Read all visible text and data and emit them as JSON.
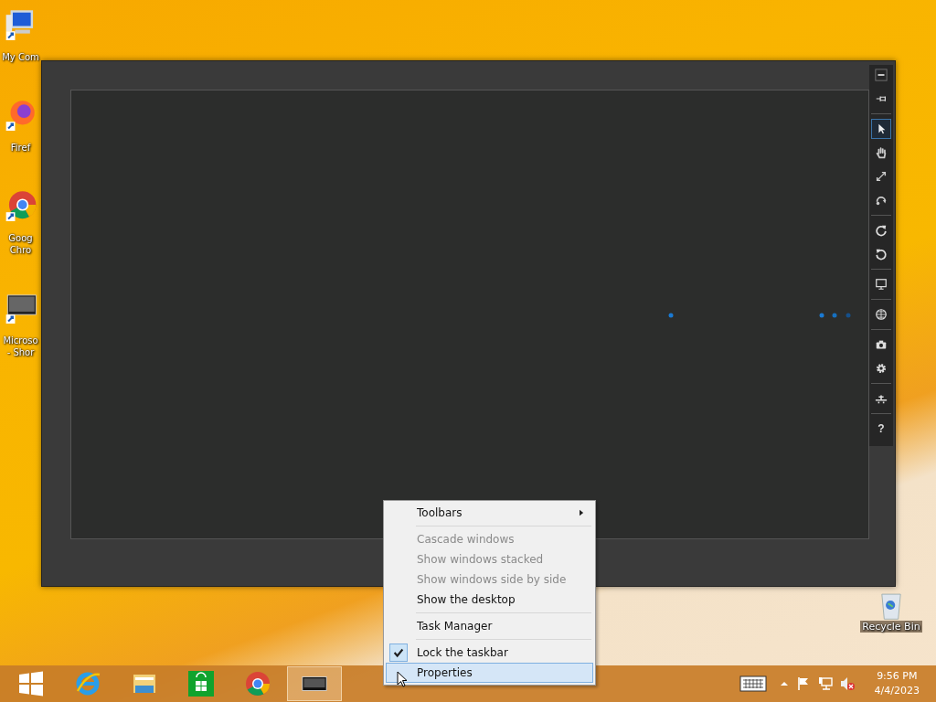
{
  "desktop_icons": [
    {
      "lines": [
        "My Com"
      ]
    },
    {
      "lines": [
        "Firef"
      ]
    },
    {
      "lines": [
        "Goog",
        "Chro"
      ]
    },
    {
      "lines": [
        "Microso",
        "- Shor"
      ]
    }
  ],
  "recycle_bin": {
    "label": "Recycle Bin"
  },
  "app_window": {
    "toolbar_groups": [
      [
        {
          "selected": false
        },
        {
          "selected": false
        }
      ],
      [
        {
          "selected": true
        },
        {
          "selected": false
        },
        {
          "selected": false
        },
        {
          "selected": false
        }
      ],
      [
        {
          "selected": false
        },
        {
          "selected": false
        }
      ],
      [
        {
          "selected": false
        }
      ],
      [
        {
          "selected": false
        }
      ],
      [
        {
          "selected": false
        },
        {
          "selected": false
        }
      ],
      [
        {
          "selected": false
        }
      ],
      [
        {
          "selected": false,
          "text": "?"
        }
      ]
    ]
  },
  "context_menu": [
    {
      "kind": "item",
      "label": "Toolbars",
      "disabled": false,
      "checked": false,
      "selected": false,
      "submenu": true
    },
    {
      "kind": "separator"
    },
    {
      "kind": "item",
      "label": "Cascade windows",
      "disabled": true,
      "checked": false,
      "selected": false,
      "submenu": false
    },
    {
      "kind": "item",
      "label": "Show windows stacked",
      "disabled": true,
      "checked": false,
      "selected": false,
      "submenu": false
    },
    {
      "kind": "item",
      "label": "Show windows side by side",
      "disabled": true,
      "checked": false,
      "selected": false,
      "submenu": false
    },
    {
      "kind": "item",
      "label": "Show the desktop",
      "disabled": false,
      "checked": false,
      "selected": false,
      "submenu": false
    },
    {
      "kind": "separator"
    },
    {
      "kind": "item",
      "label": "Task Manager",
      "disabled": false,
      "checked": false,
      "selected": false,
      "submenu": false
    },
    {
      "kind": "separator"
    },
    {
      "kind": "item",
      "label": "Lock the taskbar",
      "disabled": false,
      "checked": true,
      "selected": false,
      "submenu": false
    },
    {
      "kind": "item",
      "label": "Properties",
      "disabled": false,
      "checked": false,
      "selected": true,
      "submenu": false
    }
  ],
  "taskbar": {
    "apps": [
      {
        "active": false
      },
      {
        "active": false
      },
      {
        "active": false
      },
      {
        "active": false
      },
      {
        "active": false
      },
      {
        "active": true
      }
    ],
    "time": "9:56 PM",
    "date": "4/4/2023"
  }
}
